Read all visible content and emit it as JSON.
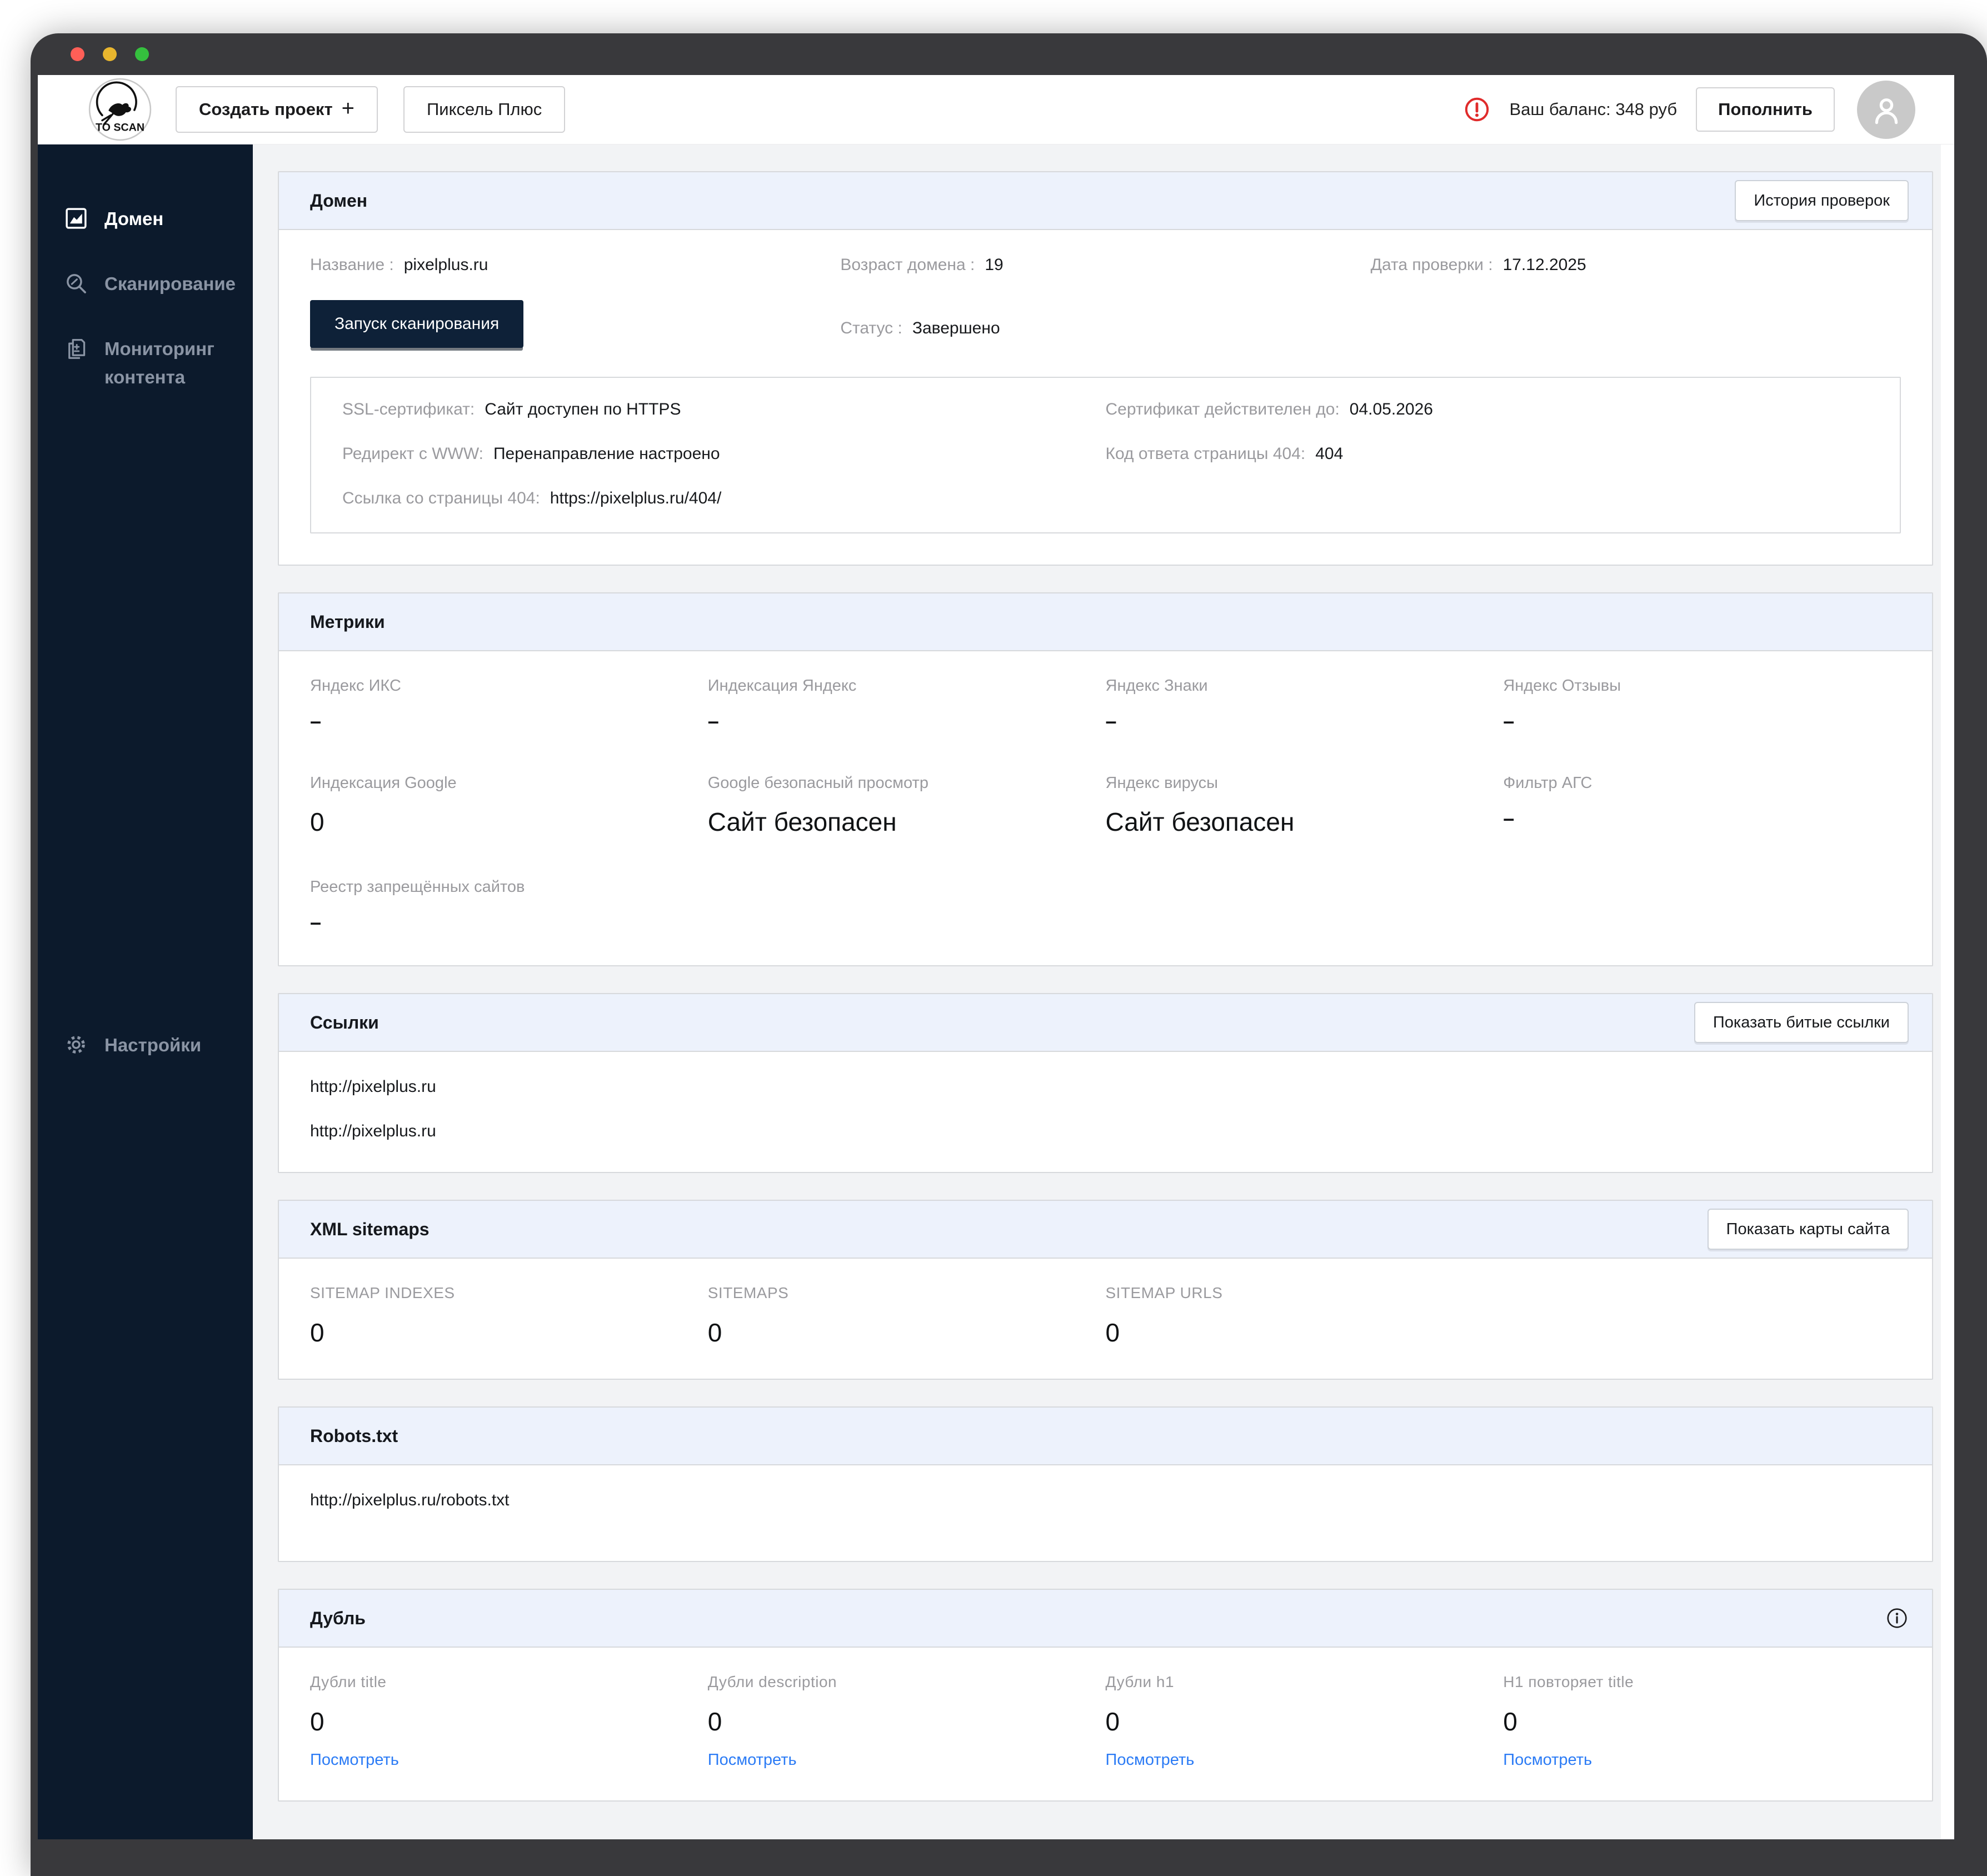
{
  "window": {
    "title_buttons": [
      "close",
      "minimize",
      "maximize"
    ]
  },
  "header": {
    "logo_text": "TO SCAN",
    "create_project_label": "Создать проект",
    "create_project_plus": "+",
    "project_name": "Пиксель Плюс",
    "balance_text": "Ваш баланс: 348 руб",
    "topup_label": "Пополнить"
  },
  "sidebar": {
    "items": [
      {
        "label": "Домен",
        "icon": "chart-icon",
        "active": true
      },
      {
        "label": "Сканирование",
        "icon": "search-icon",
        "active": false
      },
      {
        "label": "Мониторинг контента",
        "icon": "documents-icon",
        "active": false
      },
      {
        "label": "Настройки",
        "icon": "gear-icon",
        "active": false
      }
    ]
  },
  "domain_panel": {
    "title": "Домен",
    "history_button": "История проверок",
    "name_label": "Название :",
    "name_value": "pixelplus.ru",
    "age_label": "Возраст домена :",
    "age_value": "19",
    "check_date_label": "Дата проверки :",
    "check_date_value": "17.12.2025",
    "scan_button": "Запуск сканирования",
    "status_label": "Статус :",
    "status_value": "Завершено",
    "ssl": {
      "ssl_label": "SSL-сертификат:",
      "ssl_value": "Сайт доступен по HTTPS",
      "cert_label": "Сертификат действителен до:",
      "cert_value": "04.05.2026",
      "redirect_label": "Редирект с WWW:",
      "redirect_value": "Перенаправление настроено",
      "code404_label": "Код ответа страницы 404:",
      "code404_value": "404",
      "link404_label": "Ссылка со страницы 404:",
      "link404_value": "https://pixelplus.ru/404/"
    }
  },
  "metrics_panel": {
    "title": "Метрики",
    "items": [
      {
        "label": "Яндекс ИКС",
        "value": "–"
      },
      {
        "label": "Индексация Яндекс",
        "value": "–"
      },
      {
        "label": "Яндекс Знаки",
        "value": "–"
      },
      {
        "label": "Яндекс Отзывы",
        "value": "–"
      },
      {
        "label": "Индексация Google",
        "value": "0"
      },
      {
        "label": "Google безопасный просмотр",
        "value": "Сайт безопасен"
      },
      {
        "label": "Яндекс вирусы",
        "value": "Сайт безопасен"
      },
      {
        "label": "Фильтр АГС",
        "value": "–"
      },
      {
        "label": "Реестр запрещённых сайтов",
        "value": "–"
      }
    ]
  },
  "links_panel": {
    "title": "Ссылки",
    "button": "Показать битые ссылки",
    "links": [
      "http://pixelplus.ru",
      "http://pixelplus.ru"
    ]
  },
  "sitemaps_panel": {
    "title": "XML sitemaps",
    "button": "Показать карты сайта",
    "stats": [
      {
        "label": "SITEMAP INDEXES",
        "value": "0"
      },
      {
        "label": "SITEMAPS",
        "value": "0"
      },
      {
        "label": "SITEMAP URLS",
        "value": "0"
      }
    ]
  },
  "robots_panel": {
    "title": "Robots.txt",
    "link": "http://pixelplus.ru/robots.txt"
  },
  "duplicates_panel": {
    "title": "Дубль",
    "view_label": "Посмотреть",
    "stats": [
      {
        "label": "Дубли title",
        "value": "0"
      },
      {
        "label": "Дубли description",
        "value": "0"
      },
      {
        "label": "Дубли h1",
        "value": "0"
      },
      {
        "label": "H1 повторяет title",
        "value": "0"
      }
    ]
  },
  "colors": {
    "sidebar_bg": "#0c1a2c",
    "panel_header_bg": "#edf2fc",
    "accent_navy": "#0e2138",
    "link_blue": "#2b7bf5",
    "alert_red": "#e02b2b",
    "label_gray": "#9a9a9e"
  }
}
